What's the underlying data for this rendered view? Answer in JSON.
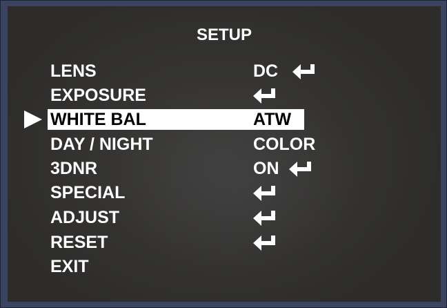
{
  "menu": {
    "title": "SETUP",
    "selected_index": 2,
    "items": [
      {
        "label": "LENS",
        "value": "DC",
        "has_submenu": true
      },
      {
        "label": "EXPOSURE",
        "value": "",
        "has_submenu": true
      },
      {
        "label": "WHITE BAL",
        "value": "ATW",
        "has_submenu": false
      },
      {
        "label": "DAY / NIGHT",
        "value": "COLOR",
        "has_submenu": false
      },
      {
        "label": "3DNR",
        "value": "ON",
        "has_submenu": true
      },
      {
        "label": "SPECIAL",
        "value": "",
        "has_submenu": true
      },
      {
        "label": "ADJUST",
        "value": "",
        "has_submenu": true
      },
      {
        "label": "RESET",
        "value": "",
        "has_submenu": true
      },
      {
        "label": "EXIT",
        "value": "",
        "has_submenu": false
      }
    ]
  },
  "colors": {
    "text": "#ffffff",
    "highlight": "#ffffff",
    "selected_text": "#000000",
    "frame": "#3a4460"
  },
  "icons": {
    "submenu": "enter-arrow-icon",
    "cursor": "pointer-triangle-icon"
  }
}
